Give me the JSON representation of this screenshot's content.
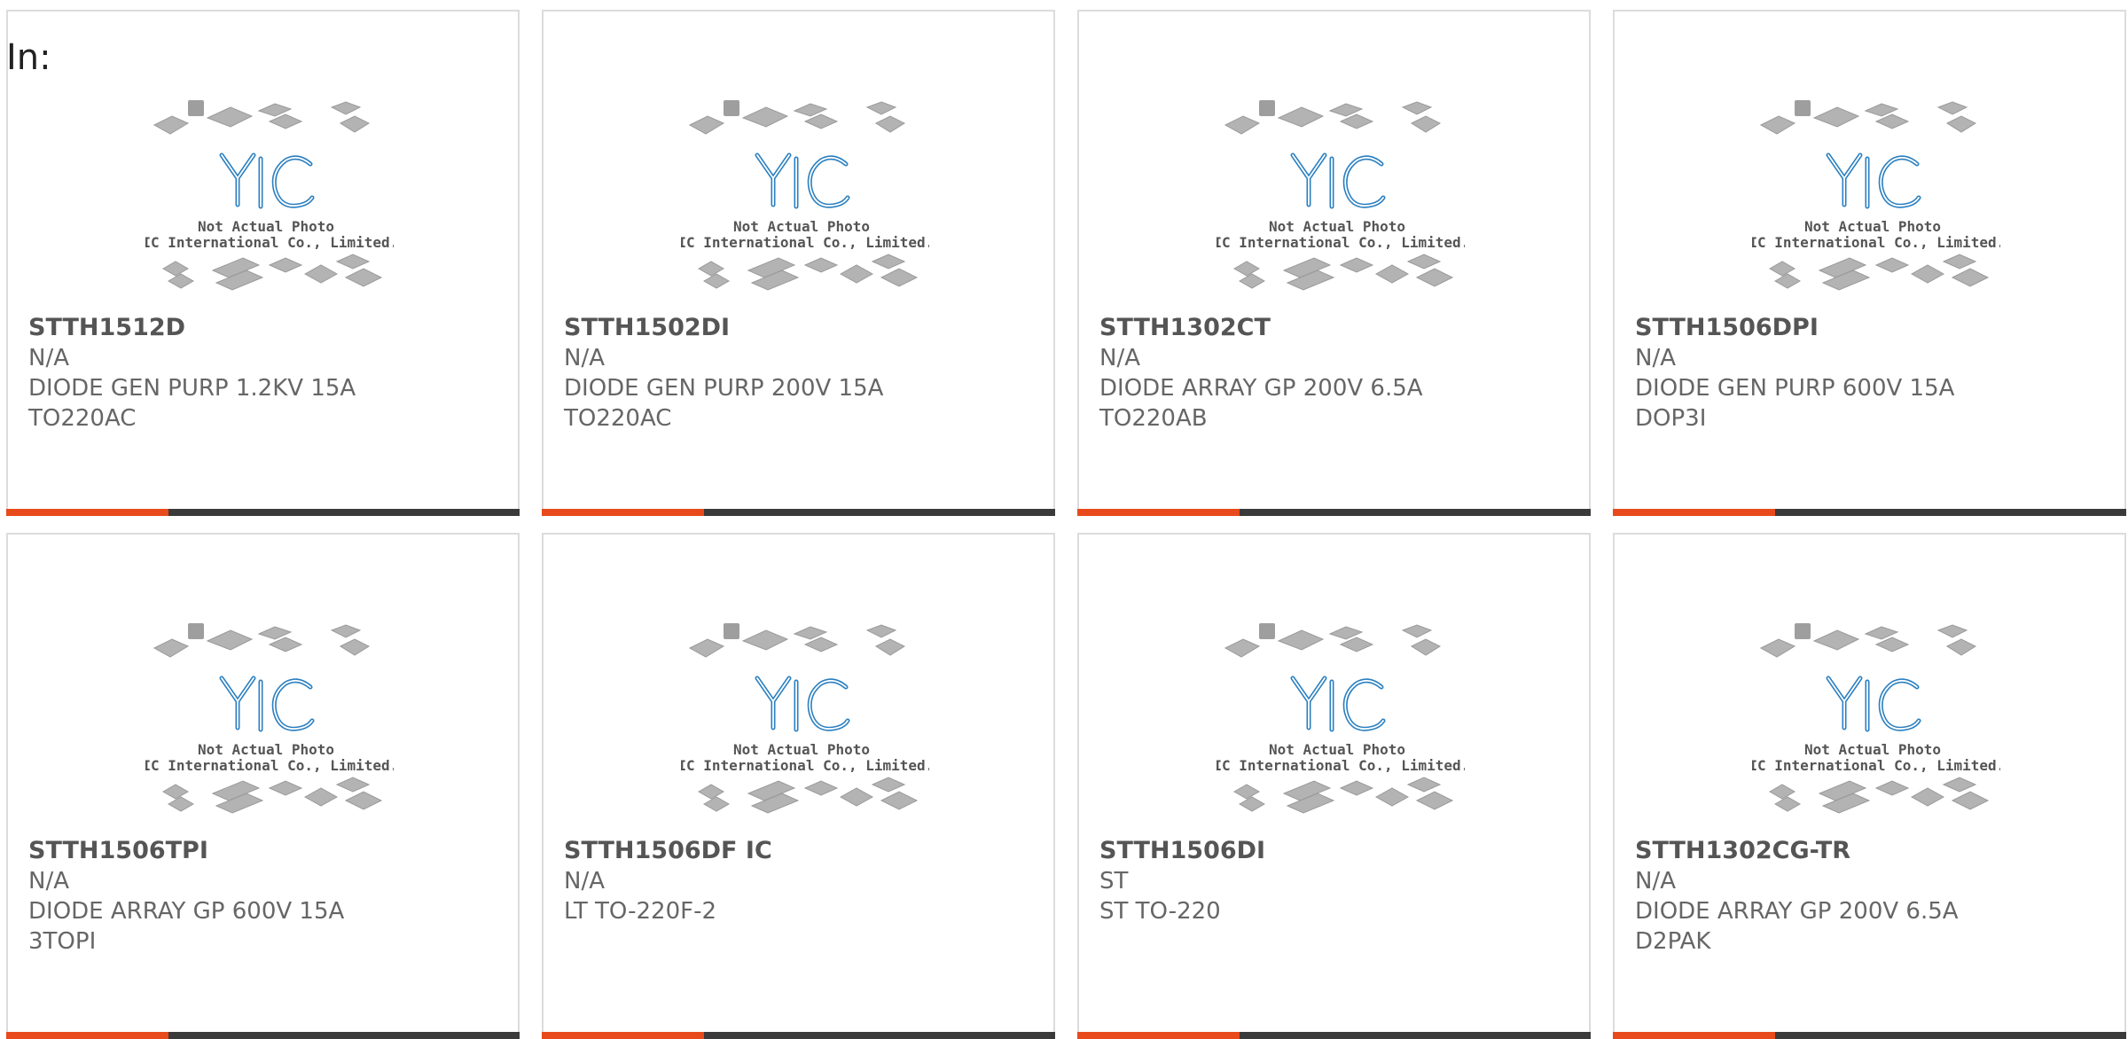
{
  "header": {
    "in_label": "In:"
  },
  "photo": {
    "caption_line1": "Not Actual Photo",
    "caption_line2": "YIC International Co., Limited.",
    "logo_text": "YIC"
  },
  "colors": {
    "accent": "#e84a1c",
    "bar": "#3a3a3a",
    "border": "#dcdcdc",
    "logo": "#2a7fc0"
  },
  "products": [
    {
      "part": "STTH1512D",
      "mfr": "N/A",
      "desc": "DIODE GEN PURP 1.2KV 15A",
      "pkg": "TO220AC"
    },
    {
      "part": "STTH1502DI",
      "mfr": "N/A",
      "desc": "DIODE GEN PURP 200V 15A",
      "pkg": "TO220AC"
    },
    {
      "part": "STTH1302CT",
      "mfr": "N/A",
      "desc": "DIODE ARRAY GP 200V 6.5A",
      "pkg": "TO220AB"
    },
    {
      "part": "STTH1506DPI",
      "mfr": "N/A",
      "desc": "DIODE GEN PURP 600V 15A",
      "pkg": "DOP3I"
    },
    {
      "part": "STTH1506TPI",
      "mfr": "N/A",
      "desc": "DIODE ARRAY GP 600V 15A",
      "pkg": "3TOPI"
    },
    {
      "part": "STTH1506DF IC",
      "mfr": "N/A",
      "desc": "LT TO-220F-2",
      "pkg": ""
    },
    {
      "part": "STTH1506DI",
      "mfr": "ST",
      "desc": "ST TO-220",
      "pkg": ""
    },
    {
      "part": "STTH1302CG-TR",
      "mfr": "N/A",
      "desc": "DIODE ARRAY GP 200V 6.5A",
      "pkg": "D2PAK"
    }
  ]
}
